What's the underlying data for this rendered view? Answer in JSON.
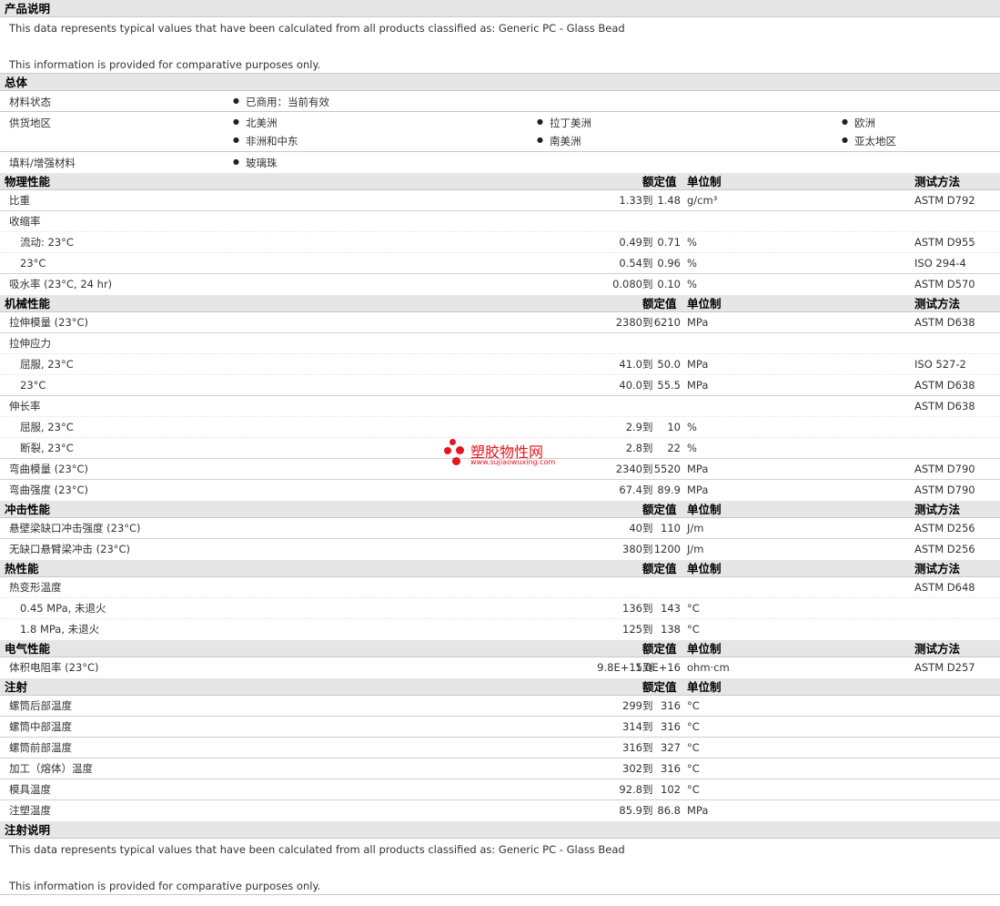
{
  "product_desc": {
    "title": "产品说明",
    "line1": "This data represents typical values that have been calculated from all products classified as: Generic PC - Glass Bead",
    "line2": "This information is provided for comparative purposes only."
  },
  "general": {
    "title": "总体",
    "material_status_label": "材料状态",
    "material_status_value": "已商用：当前有效",
    "supply_label": "供货地区",
    "regions": [
      "北美洲",
      "拉丁美洲",
      "欧洲",
      "非洲和中东",
      "南美洲",
      "亚太地区"
    ],
    "filler_label": "填料/增强材料",
    "filler_value": "玻璃珠"
  },
  "headers": {
    "value": "额定值",
    "unit": "单位制",
    "test": "测试方法"
  },
  "to_word": "到",
  "physical": {
    "title": "物理性能",
    "rows": [
      {
        "label": "比重",
        "v1": "1.33",
        "v2": "1.48",
        "unit": "g/cm³",
        "test": "ASTM D792"
      },
      {
        "label": "收缩率",
        "v1": "",
        "v2": "",
        "unit": "",
        "test": ""
      },
      {
        "label": "流动: 23°C",
        "v1": "0.49",
        "v2": "0.71",
        "unit": "%",
        "test": "ASTM D955"
      },
      {
        "label": "23°C",
        "v1": "0.54",
        "v2": "0.96",
        "unit": "%",
        "test": "ISO 294-4"
      },
      {
        "label": "吸水率 (23°C, 24 hr)",
        "v1": "0.080",
        "v2": "0.10",
        "unit": "%",
        "test": "ASTM D570"
      }
    ]
  },
  "mechanical": {
    "title": "机械性能",
    "rows": [
      {
        "label": "拉伸模量 (23°C)",
        "v1": "2380",
        "v2": "6210",
        "unit": "MPa",
        "test": "ASTM D638"
      },
      {
        "label": "拉伸应力",
        "v1": "",
        "v2": "",
        "unit": "",
        "test": ""
      },
      {
        "label": "屈服, 23°C",
        "v1": "41.0",
        "v2": "50.0",
        "unit": "MPa",
        "test": "ISO 527-2"
      },
      {
        "label": "23°C",
        "v1": "40.0",
        "v2": "55.5",
        "unit": "MPa",
        "test": "ASTM D638"
      },
      {
        "label": "伸长率",
        "v1": "",
        "v2": "",
        "unit": "",
        "test": "ASTM D638"
      },
      {
        "label": "屈服, 23°C",
        "v1": "2.9",
        "v2": "10",
        "unit": "%",
        "test": ""
      },
      {
        "label": "断裂, 23°C",
        "v1": "2.8",
        "v2": "22",
        "unit": "%",
        "test": ""
      },
      {
        "label": "弯曲模量 (23°C)",
        "v1": "2340",
        "v2": "5520",
        "unit": "MPa",
        "test": "ASTM D790"
      },
      {
        "label": "弯曲强度 (23°C)",
        "v1": "67.4",
        "v2": "89.9",
        "unit": "MPa",
        "test": "ASTM D790"
      }
    ]
  },
  "impact": {
    "title": "冲击性能",
    "rows": [
      {
        "label": "悬壁梁缺口冲击强度 (23°C)",
        "v1": "40",
        "v2": "110",
        "unit": "J/m",
        "test": "ASTM D256"
      },
      {
        "label": "无缺口悬臂梁冲击 (23°C)",
        "v1": "380",
        "v2": "1200",
        "unit": "J/m",
        "test": "ASTM D256"
      }
    ]
  },
  "thermal": {
    "title": "热性能",
    "rows": [
      {
        "label": "热变形温度",
        "v1": "",
        "v2": "",
        "unit": "",
        "test": "ASTM D648"
      },
      {
        "label": "0.45 MPa, 未退火",
        "v1": "136",
        "v2": "143",
        "unit": "°C",
        "test": ""
      },
      {
        "label": "1.8 MPa, 未退火",
        "v1": "125",
        "v2": "138",
        "unit": "°C",
        "test": ""
      }
    ]
  },
  "electrical": {
    "title": "电气性能",
    "rows": [
      {
        "label": "体积电阻率 (23°C)",
        "v1": "9.8E+15",
        "v2": "1.0E+16",
        "unit": "ohm·cm",
        "test": "ASTM D257"
      }
    ]
  },
  "injection": {
    "title": "注射",
    "rows": [
      {
        "label": "螺筒后部温度",
        "v1": "299",
        "v2": "316",
        "unit": "°C",
        "test": ""
      },
      {
        "label": "螺筒中部温度",
        "v1": "314",
        "v2": "316",
        "unit": "°C",
        "test": ""
      },
      {
        "label": "螺筒前部温度",
        "v1": "316",
        "v2": "327",
        "unit": "°C",
        "test": ""
      },
      {
        "label": "加工（熔体）温度",
        "v1": "302",
        "v2": "316",
        "unit": "°C",
        "test": ""
      },
      {
        "label": "模具温度",
        "v1": "92.8",
        "v2": "102",
        "unit": "°C",
        "test": ""
      },
      {
        "label": "注塑温度",
        "v1": "85.9",
        "v2": "86.8",
        "unit": "MPa",
        "test": ""
      }
    ]
  },
  "injection_desc": {
    "title": "注射说明",
    "line1": "This data represents typical values that have been calculated from all products classified as: Generic PC - Glass Bead",
    "line2": "This information is provided for comparative purposes only."
  },
  "watermark": {
    "text": "塑胶物性网",
    "url": "www.sujiaowuxing.com",
    "color": "#e8141c"
  }
}
